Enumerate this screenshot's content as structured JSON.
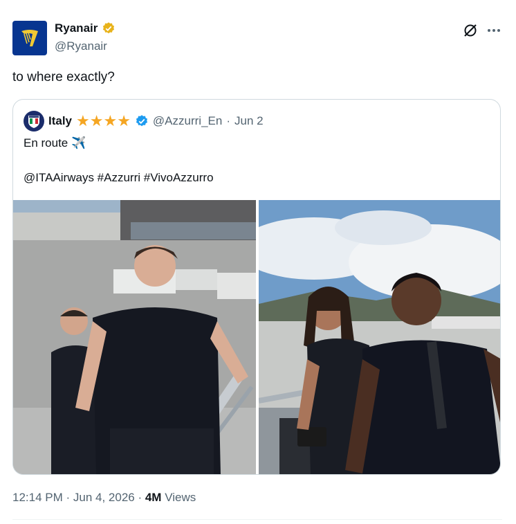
{
  "author": {
    "name": "Ryanair",
    "handle": "@Ryanair",
    "verified_color": "#e8b31b",
    "avatar_color": "#073590"
  },
  "actions": {
    "grok_icon": "grok-icon",
    "more_icon": "more-icon"
  },
  "tweet": {
    "text": "to where exactly?"
  },
  "quote": {
    "name": "Italy",
    "stars": "★★★★",
    "handle": "@Azzurri_En",
    "separator": "·",
    "date": "Jun 2",
    "line1": "En route ✈️",
    "line2": "@ITAAirways #Azzurri #VivoAzzurro",
    "verified_color": "#1d9bf0"
  },
  "footer": {
    "time": "12:14 PM · Jun 4, 2026 · ",
    "views_count": "4M",
    "views_label": "Views"
  }
}
